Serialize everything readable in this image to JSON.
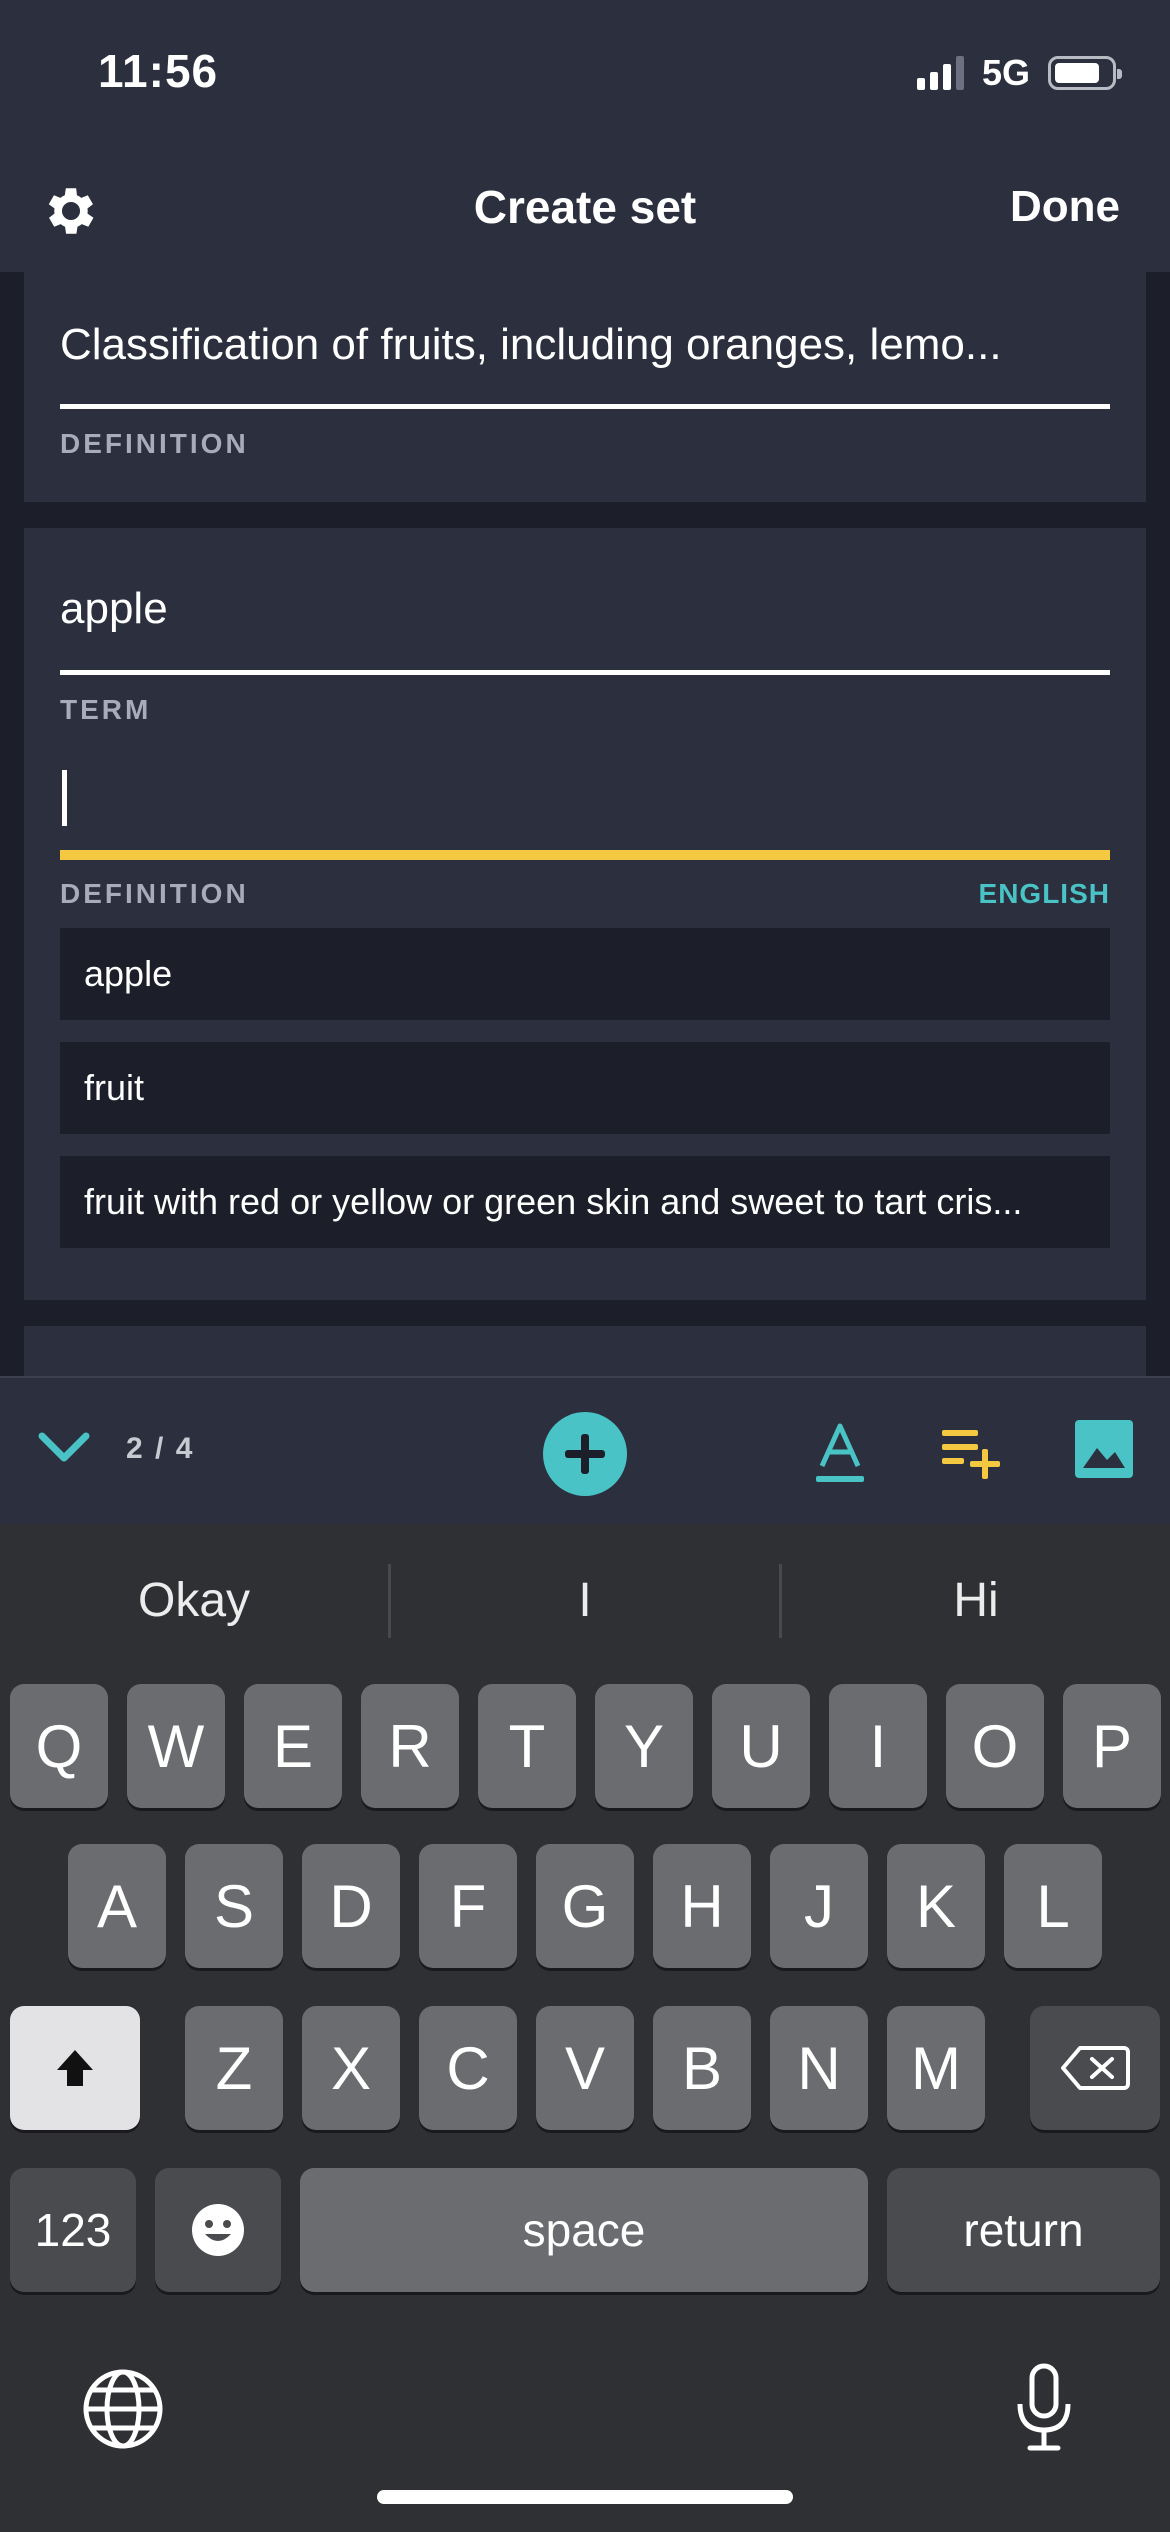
{
  "status": {
    "time": "11:56",
    "network": "5G"
  },
  "nav": {
    "title": "Create set",
    "done": "Done"
  },
  "cards": {
    "card1": {
      "text": "Classification of fruits, including oranges, lemo...",
      "label": "DEFINITION"
    },
    "card2": {
      "term_value": "apple",
      "term_label": "TERM",
      "definition_label": "DEFINITION",
      "language": "ENGLISH",
      "suggestions": [
        "apple",
        "fruit",
        "fruit with red or yellow or green skin and sweet to tart cris..."
      ]
    }
  },
  "toolbar": {
    "count": "2 / 4"
  },
  "keyboard": {
    "predictions": [
      "Okay",
      "I",
      "Hi"
    ],
    "row1": [
      "Q",
      "W",
      "E",
      "R",
      "T",
      "Y",
      "U",
      "I",
      "O",
      "P"
    ],
    "row2": [
      "A",
      "S",
      "D",
      "F",
      "G",
      "H",
      "J",
      "K",
      "L"
    ],
    "row3": [
      "Z",
      "X",
      "C",
      "V",
      "B",
      "N",
      "M"
    ],
    "numbers": "123",
    "space": "space",
    "return": "return"
  },
  "colors": {
    "accent": "#4ac3c6",
    "active_underline": "#f5c842",
    "background": "#2b2f3e"
  }
}
